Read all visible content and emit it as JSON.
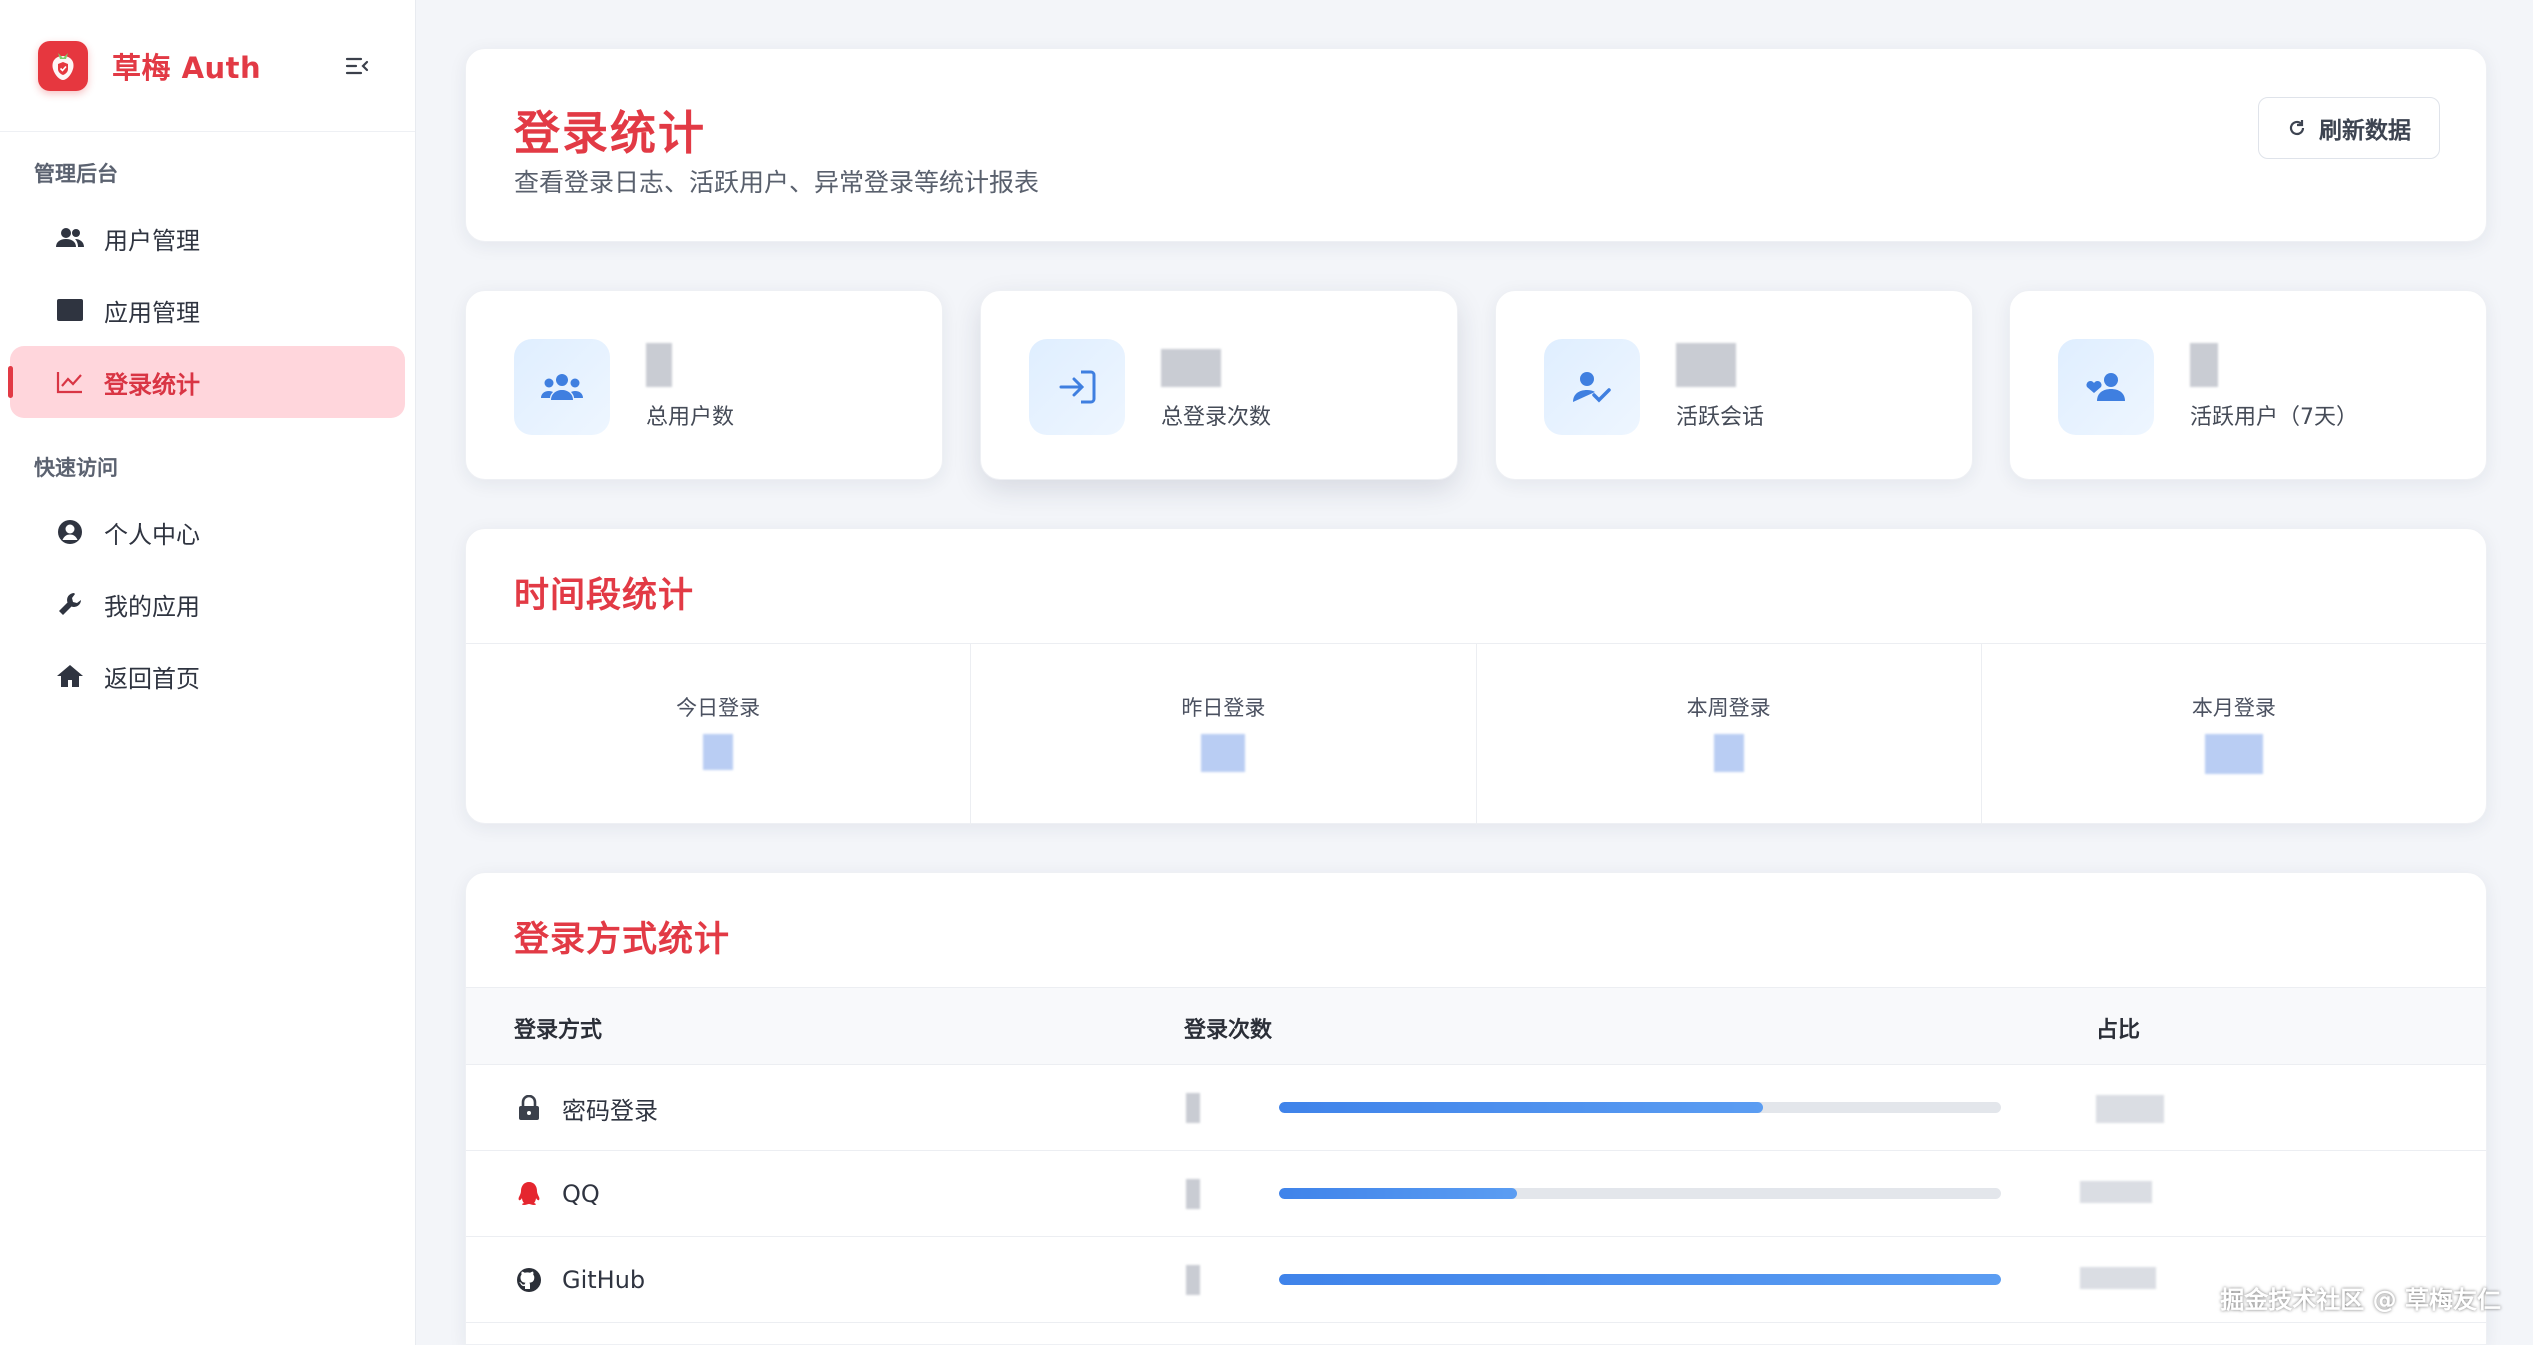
{
  "app": {
    "title": "草梅 Auth"
  },
  "sidebar": {
    "group1": "管理后台",
    "group2": "快速访问",
    "items": [
      {
        "label": "用户管理",
        "icon": "users-icon"
      },
      {
        "label": "应用管理",
        "icon": "window-icon"
      },
      {
        "label": "登录统计",
        "icon": "chart-line-icon",
        "active": true
      },
      {
        "label": "个人中心",
        "icon": "user-circle-icon"
      },
      {
        "label": "我的应用",
        "icon": "wrench-icon"
      },
      {
        "label": "返回首页",
        "icon": "home-icon"
      }
    ]
  },
  "header": {
    "title": "登录统计",
    "subtitle": "查看登录日志、活跃用户、异常登录等统计报表",
    "refresh_label": "刷新数据"
  },
  "stats": [
    {
      "label": "总用户数",
      "icon": "users-group-icon"
    },
    {
      "label": "总登录次数",
      "icon": "sign-in-icon"
    },
    {
      "label": "活跃会话",
      "icon": "user-check-icon"
    },
    {
      "label": "活跃用户（7天）",
      "icon": "user-heart-icon"
    }
  ],
  "time_section": {
    "title": "时间段统计",
    "items": [
      {
        "label": "今日登录"
      },
      {
        "label": "昨日登录"
      },
      {
        "label": "本周登录"
      },
      {
        "label": "本月登录"
      }
    ]
  },
  "methods_section": {
    "title": "登录方式统计",
    "columns": [
      "登录方式",
      "登录次数",
      "占比"
    ],
    "rows": [
      {
        "name": "密码登录",
        "icon": "lock-icon",
        "share": 0.67
      },
      {
        "name": "QQ",
        "icon": "qq-icon",
        "share": 0.33
      },
      {
        "name": "GitHub",
        "icon": "github-icon",
        "share": 1.0
      }
    ]
  },
  "colors": {
    "accent": "#e23a45",
    "bar": "#3f83ea",
    "active_bg": "#ffd6dc"
  },
  "watermark": "掘金技术社区 @ 草梅友仁"
}
